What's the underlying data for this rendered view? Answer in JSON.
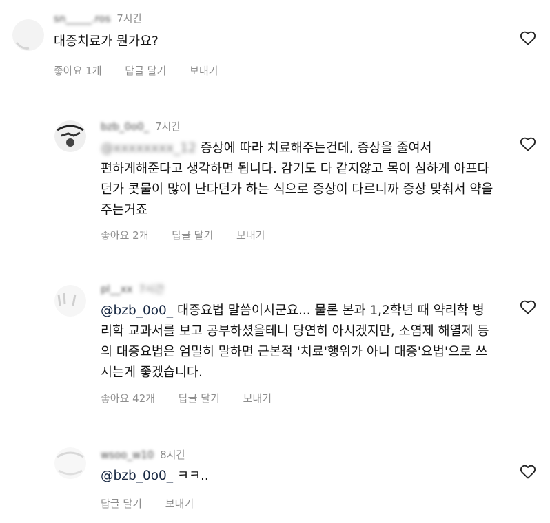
{
  "comments": [
    {
      "username": "sn_____.ros",
      "time": "7시간",
      "text": "대증치료가 뭔가요?",
      "likes": "좋아요 1개",
      "reply": "답글 달기",
      "send": "보내기"
    },
    {
      "username": "bzb_0o0_",
      "time": "7시간",
      "mention_hidden": "@xxxxxxxx_12",
      "text_line1": " 증상에 따라 치료해주는건데, 증상을 줄여서",
      "text_rest": "편하게해준다고 생각하면 됩니다. 감기도 다 같지않고 목이 심하게 아프다던가 콧물이 많이 난다던가 하는 식으로 증상이 다르니까 증상 맞춰서 약을 주는거죠",
      "likes": "좋아요 2개",
      "reply": "답글 달기",
      "send": "보내기"
    },
    {
      "username": "pl__xx",
      "time": "7시간",
      "mention": "@bzb_0o0_",
      "text": " 대증요법 말씀이시군요... 물론 본과 1,2학년 때 약리학 병리학 교과서를 보고 공부하셨을테니 당연히 아시겠지만, 소염제 해열제 등의 대증요법은 엄밀히 말하면 근본적 '치료'행위가 아니 대증'요법'으로 쓰시는게 좋겠습니다.",
      "likes": "좋아요 42개",
      "reply": "답글 달기",
      "send": "보내기"
    },
    {
      "username": "wsoo_w10",
      "time": "8시간",
      "mention": "@bzb_0o0_",
      "text": " ㅋㅋ..",
      "reply": "답글 달기",
      "send": "보내기"
    }
  ],
  "icons": {
    "like": "heart-outline-icon"
  },
  "colors": {
    "text": "#141414",
    "meta": "#8e8e8e",
    "mention": "#1a2a44"
  }
}
